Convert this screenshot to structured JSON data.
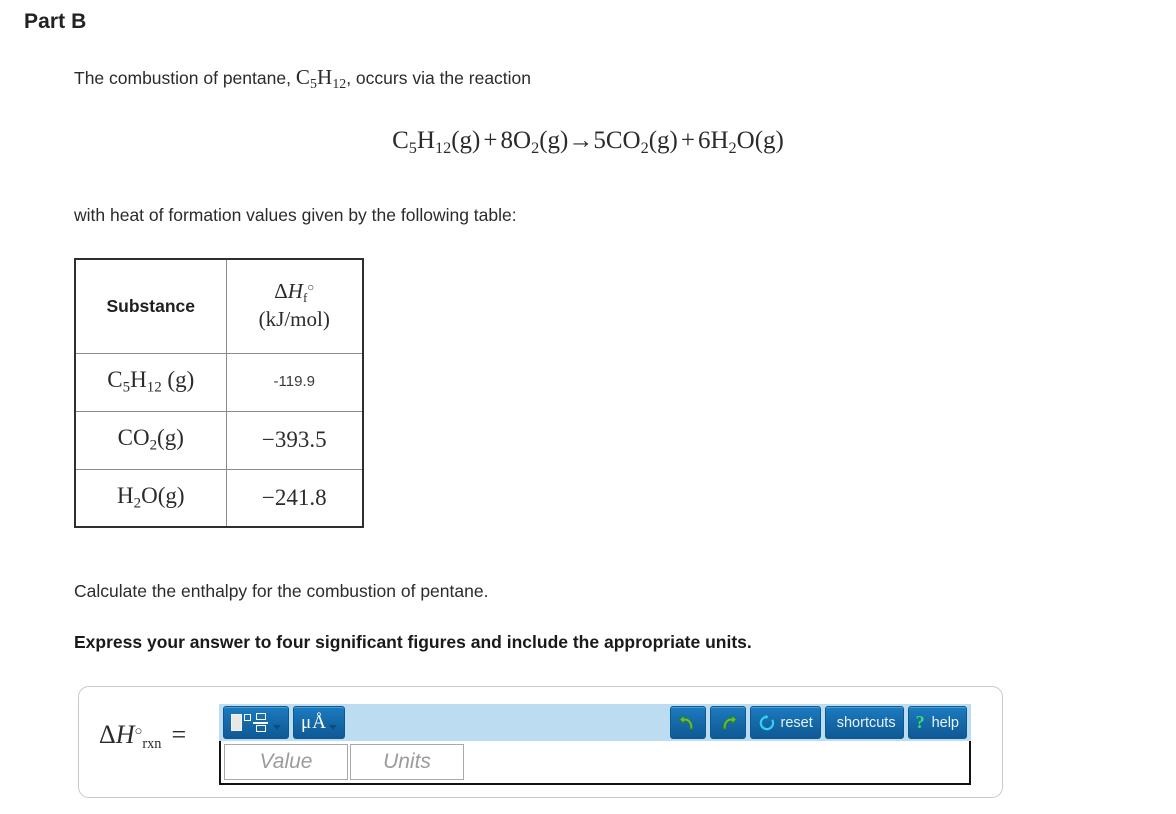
{
  "part": {
    "title": "Part B"
  },
  "problem": {
    "intro_before": "The combustion of pentane, ",
    "intro_formula": "C5H12",
    "intro_after": ", occurs via the reaction",
    "table_lead": "with heat of formation values given by the following table:",
    "equation": "C5H12(g) + 8O2(g) →5CO2(g) + 6H2O(g)",
    "equation_parts": {
      "reactant1": "C5H12(g)",
      "plus1": "+",
      "reactant2": "8O2(g)",
      "arrow": "→",
      "product1": "5CO2(g)",
      "plus2": "+",
      "product2": "6H2O(g)"
    },
    "calc_instruction": "Calculate the enthalpy for the combustion of pentane.",
    "express_instruction": "Express your answer to four significant figures and include the appropriate units."
  },
  "table": {
    "headers": {
      "substance": "Substance",
      "delta_h": "ΔHf°",
      "delta_h_units": "(kJ/mol)"
    },
    "rows": [
      {
        "substance": "C5H12 (g)",
        "value": "-119.9",
        "style": "sans"
      },
      {
        "substance": "CO2(g)",
        "value": "−393.5",
        "style": "serif"
      },
      {
        "substance": "H2O(g)",
        "value": "−241.8",
        "style": "serif"
      }
    ]
  },
  "answer": {
    "label": "ΔH°rxn",
    "equals": "=",
    "value_placeholder": "Value",
    "units_placeholder": "Units",
    "value": "",
    "units": "",
    "toolbar": {
      "template_button": "template-menu",
      "units_button": "μÅ",
      "undo": "undo",
      "redo": "redo",
      "reset": "reset",
      "shortcuts": "shortcuts",
      "help": "help",
      "help_symbol": "?"
    }
  },
  "colors": {
    "toolbar_background": "#bcdcf2",
    "button_blue": "#1567a6",
    "arrow_green": "#5ec24a",
    "reset_cyan": "#2fd4f0",
    "help_green": "#35e06a",
    "text": "#2b2b2b",
    "table_border": "#2e2e2e",
    "table_inner_border": "#8b8b8b",
    "answer_box_border": "#c9c9c9",
    "placeholder_gray": "#9b9b9b"
  }
}
